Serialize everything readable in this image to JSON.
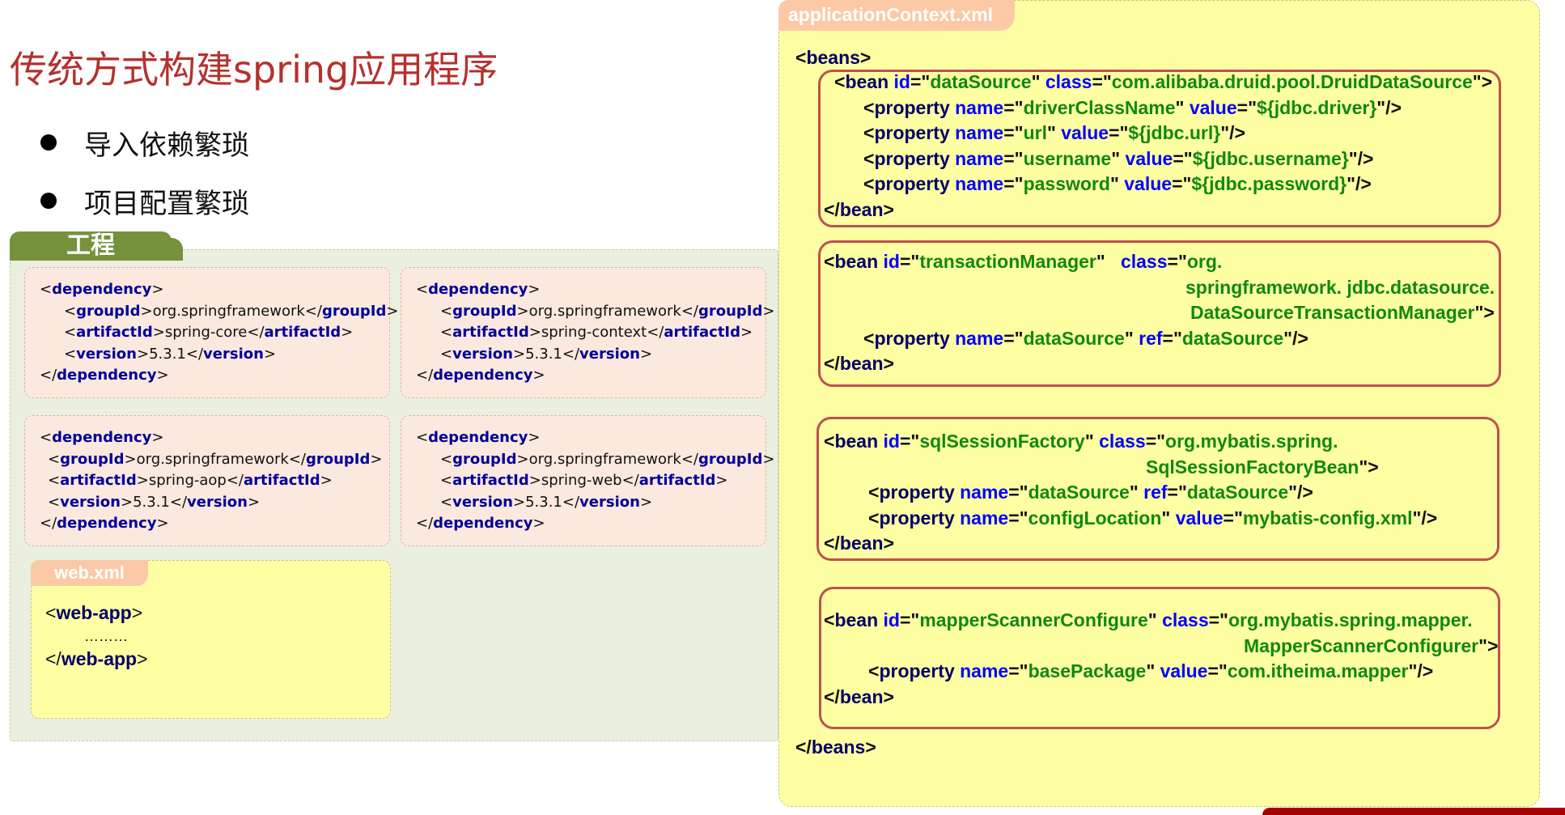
{
  "title": "传统方式构建spring应用程序",
  "bullets": [
    "导入依赖繁琐",
    "项目配置繁琐"
  ],
  "project": {
    "tab_label": "工程",
    "dependencies": [
      {
        "artifactId": "spring-core",
        "groupId": "org.springframework",
        "version": "5.3.1"
      },
      {
        "artifactId": "spring-context",
        "groupId": "org.springframework",
        "version": "5.3.1"
      },
      {
        "artifactId": "spring-aop",
        "groupId": "org.springframework",
        "version": "5.3.1"
      },
      {
        "artifactId": "spring-web",
        "groupId": "org.springframework",
        "version": "5.3.1"
      }
    ],
    "tags": {
      "dependency": "dependency",
      "groupId": "groupId",
      "artifactId": "artifactId",
      "version": "version"
    },
    "web_xml": {
      "tab_label": "web.xml",
      "tag": "web-app",
      "ellipsis": "………"
    }
  },
  "app_context": {
    "tab_label": "applicationContext.xml",
    "beans_tag": "beans",
    "bean_tag": "bean",
    "property_tag": "property",
    "beans": [
      {
        "id": "dataSource",
        "class_lines": [
          "com.alibaba.druid.pool.DruidDataSource"
        ],
        "properties": [
          {
            "name": "driverClassName",
            "attr": "value",
            "val": "${jdbc.driver}"
          },
          {
            "name": "url",
            "attr": "value",
            "val": "${jdbc.url}"
          },
          {
            "name": "username",
            "attr": "value",
            "val": "${jdbc.username}"
          },
          {
            "name": "password",
            "attr": "value",
            "val": "${jdbc.password}"
          }
        ]
      },
      {
        "id": "transactionManager",
        "class_lines": [
          "org.",
          "springframework. jdbc.datasource.",
          "DataSourceTransactionManager"
        ],
        "properties": [
          {
            "name": "dataSource",
            "attr": "ref",
            "val": "dataSource"
          }
        ]
      },
      {
        "id": "sqlSessionFactory",
        "class_lines": [
          "org.mybatis.spring.",
          "SqlSessionFactoryBean"
        ],
        "properties": [
          {
            "name": "dataSource",
            "attr": "ref",
            "val": "dataSource"
          },
          {
            "name": "configLocation",
            "attr": "value",
            "val": "mybatis-config.xml"
          }
        ]
      },
      {
        "id": "mapperScannerConfigure",
        "class_lines": [
          "org.mybatis.spring.mapper.",
          "MapperScannerConfigurer"
        ],
        "properties": [
          {
            "name": "basePackage",
            "attr": "value",
            "val": "com.itheima.mapper"
          }
        ]
      }
    ]
  },
  "colors": {
    "title": "#b5312e",
    "project_tab": "#76923c",
    "project_bg": "#ebefe0",
    "dependency_bg": "#fbe8de",
    "xml_bg": "#fefea3",
    "file_tab": "#fcc9a7",
    "bean_frame": "#c0504d",
    "tag_name": "#000066",
    "attr_name": "#0000ff",
    "attr_value": "#118811"
  }
}
